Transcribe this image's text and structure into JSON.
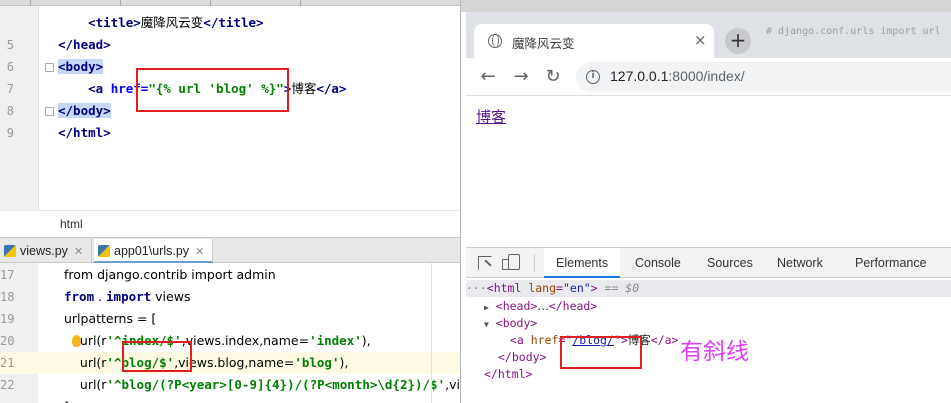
{
  "top_editor": {
    "lines": [
      {
        "ln": "",
        "indent": "    ",
        "parts": [
          [
            "tag",
            "<title>"
          ],
          [
            "plain",
            "魔降风云变"
          ],
          [
            "tag",
            "</title>"
          ]
        ]
      },
      {
        "ln": "5",
        "indent": "",
        "parts": [
          [
            "tag",
            "</head>"
          ]
        ]
      },
      {
        "ln": "6",
        "indent": "",
        "parts": [
          [
            "tagsel",
            "<body>"
          ]
        ]
      },
      {
        "ln": "7",
        "indent": "    ",
        "parts": [
          [
            "tag",
            "<a "
          ],
          [
            "attr",
            "href="
          ],
          [
            "str",
            "\"{% url 'blog' %}\""
          ],
          [
            "tag",
            ">"
          ],
          [
            "plain",
            "博客"
          ],
          [
            "tag",
            "</a>"
          ]
        ]
      },
      {
        "ln": "8",
        "indent": "",
        "parts": [
          [
            "tagsel",
            "</body>"
          ]
        ]
      },
      {
        "ln": "9",
        "indent": "",
        "parts": [
          [
            "tag",
            "</html>"
          ]
        ]
      }
    ],
    "status_label": "html"
  },
  "bottom_editor": {
    "tabs": [
      {
        "label": "views.py",
        "active": false
      },
      {
        "label": "app01\\urls.py",
        "active": true
      }
    ],
    "lines": [
      {
        "ln": "17",
        "parts": [
          [
            "plain",
            "from django.contrib import admin"
          ]
        ]
      },
      {
        "ln": "18",
        "parts": [
          [
            "kw",
            "from"
          ],
          [
            "plain",
            " . "
          ],
          [
            "kw",
            "import"
          ],
          [
            "plain",
            " views"
          ]
        ]
      },
      {
        "ln": "19",
        "parts": [
          [
            "plain",
            "urlpatterns = ["
          ]
        ]
      },
      {
        "ln": "20",
        "parts": [
          [
            "plain",
            "    url(r"
          ],
          [
            "pstr",
            "'^index/$'"
          ],
          [
            "plain",
            ",views.index,name="
          ],
          [
            "pstr",
            "'index'"
          ],
          [
            "plain",
            "),"
          ]
        ]
      },
      {
        "ln": "21",
        "parts": [
          [
            "plain",
            "    url(r"
          ],
          [
            "pstr",
            "'^blog/$'"
          ],
          [
            "plain",
            ",views.blog,name="
          ],
          [
            "pstr",
            "'blog'"
          ],
          [
            "plain",
            "),"
          ]
        ]
      },
      {
        "ln": "22",
        "parts": [
          [
            "plain",
            "    url(r"
          ],
          [
            "pstr",
            "'^blog/(?P<year>[0-9]{4})/(?P<month>\\d{2})/$'"
          ],
          [
            "plain",
            ",vi"
          ]
        ]
      },
      {
        "ln": "",
        "parts": [
          [
            "plain",
            "]"
          ]
        ]
      }
    ]
  },
  "browser": {
    "tab_title": "魔降风云变",
    "tab_close": "×",
    "new_tab": "+",
    "ghost_text": "# django.conf.urls import url",
    "nav": {
      "back": "←",
      "forward": "→",
      "reload": "↻"
    },
    "url_host": "127.0.0.1",
    "url_rest": ":8000/index/",
    "info_icon": "i",
    "page_link": "博客"
  },
  "devtools": {
    "tabs": [
      "Elements",
      "Console",
      "Sources",
      "Network",
      "Performance"
    ],
    "active_tab": "Elements",
    "dom": {
      "html_open": {
        "prefix": "···",
        "tag": "<html ",
        "attr": "lang",
        "val": "\"en\"",
        "close": ">",
        "suffix": " == $0"
      },
      "head": {
        "tri": "▶",
        "tag": "<head>",
        "ellipsis": "…",
        "close": "</head>"
      },
      "body_open": {
        "tri": "▼",
        "tag": "<body>"
      },
      "anchor": {
        "open": "<a ",
        "attr": "href",
        "eq": "=\"",
        "val": "/blog/",
        "q": "\"",
        "gt": ">",
        "text": "博客",
        "close": "</a>"
      },
      "body_close": "</body>",
      "html_close": "</html>"
    },
    "annotation": "有斜线"
  },
  "colors": {
    "highlight_box": "#e02020",
    "annotation": "#e040fb",
    "link": "#551a8b"
  }
}
